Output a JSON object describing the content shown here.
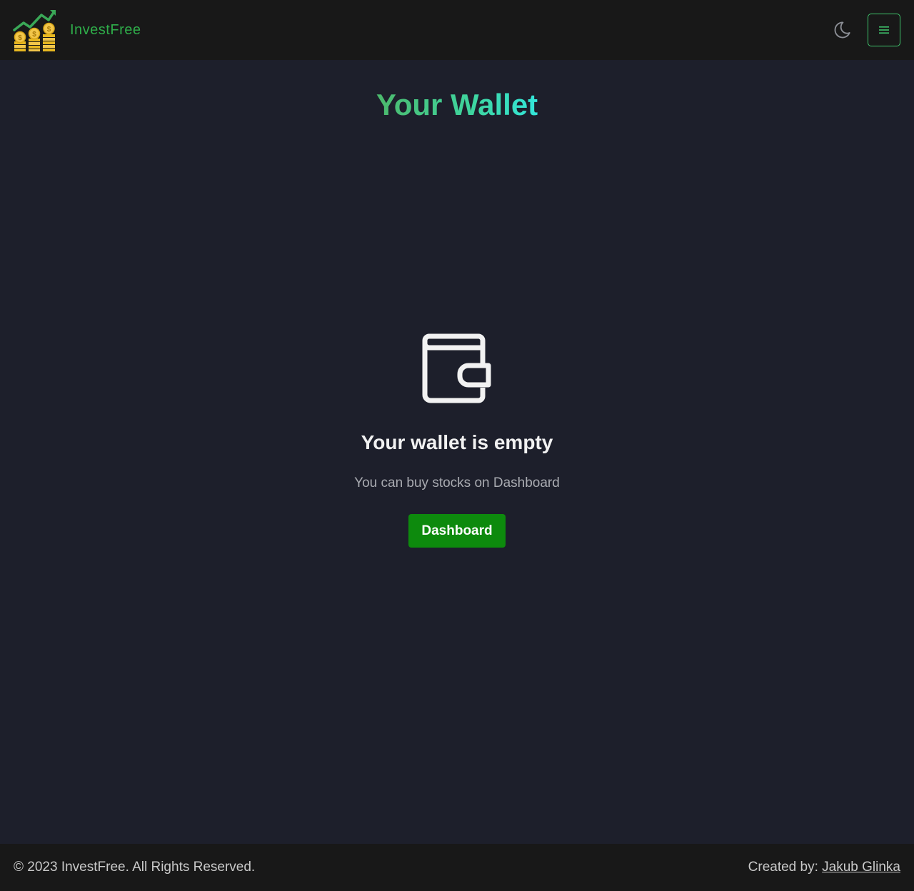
{
  "header": {
    "brand_name": "InvestFree",
    "logo_icon": "investment-growth-coins-icon",
    "theme_icon": "moon-icon",
    "menu_icon": "hamburger-menu-icon"
  },
  "main": {
    "title": "Your Wallet",
    "empty_state": {
      "icon": "wallet-icon",
      "heading": "Your wallet is empty",
      "subtext": "You can buy stocks on Dashboard",
      "button_label": "Dashboard"
    }
  },
  "footer": {
    "copyright": "© 2023 InvestFree. All Rights Reserved.",
    "credit_prefix": "Created by: ",
    "credit_name": "Jakub Glinka"
  },
  "colors": {
    "background": "#1d1f2b",
    "navbar": "#181818",
    "brand_green": "#2fae4a",
    "button_green": "#0d8a0d",
    "title_gradient_start": "#4cb96c",
    "title_gradient_end": "#33e6da"
  }
}
